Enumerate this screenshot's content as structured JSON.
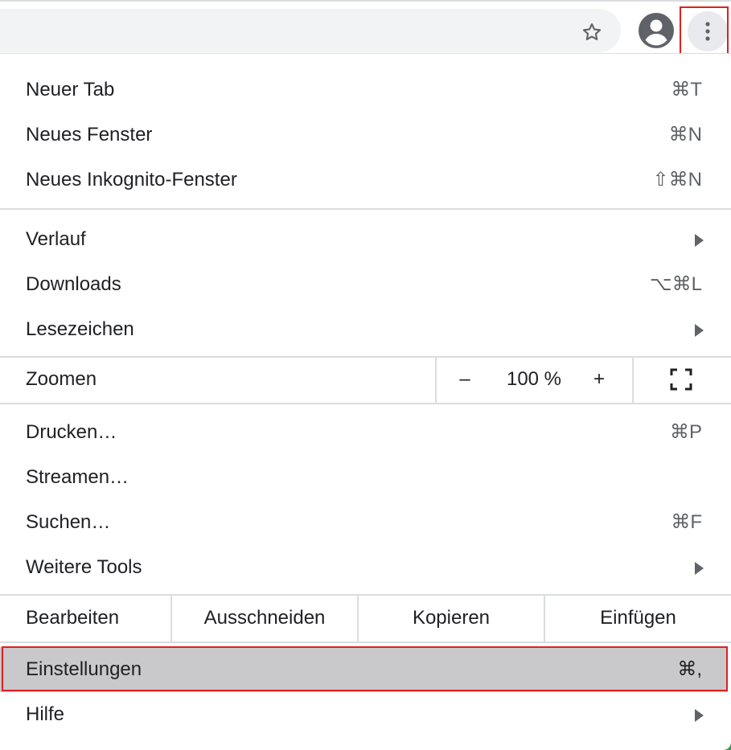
{
  "toolbar": {
    "star_icon": "star-outline-icon",
    "profile_icon": "account-circle-icon",
    "menu_icon": "more-vertical-icon"
  },
  "menu": {
    "group1": [
      {
        "label": "Neuer Tab",
        "shortcut": "⌘T"
      },
      {
        "label": "Neues Fenster",
        "shortcut": "⌘N"
      },
      {
        "label": "Neues Inkognito-Fenster",
        "shortcut": "⇧⌘N"
      }
    ],
    "group2": [
      {
        "label": "Verlauf",
        "submenu": true
      },
      {
        "label": "Downloads",
        "shortcut": "⌥⌘L"
      },
      {
        "label": "Lesezeichen",
        "submenu": true
      }
    ],
    "zoom": {
      "label": "Zoomen",
      "minus": "–",
      "value": "100 %",
      "plus": "+",
      "fullscreen_icon": "fullscreen-icon"
    },
    "group3": [
      {
        "label": "Drucken…",
        "shortcut": "⌘P"
      },
      {
        "label": "Streamen…"
      },
      {
        "label": "Suchen…",
        "shortcut": "⌘F"
      },
      {
        "label": "Weitere Tools",
        "submenu": true
      }
    ],
    "edit": {
      "label": "Bearbeiten",
      "cut": "Ausschneiden",
      "copy": "Kopieren",
      "paste": "Einfügen"
    },
    "group4": [
      {
        "label": "Einstellungen",
        "shortcut": "⌘,"
      },
      {
        "label": "Hilfe",
        "submenu": true
      }
    ]
  },
  "colors": {
    "highlight": "#c9c9cc",
    "annotation_red": "#e02020",
    "separator": "#dadce0"
  }
}
